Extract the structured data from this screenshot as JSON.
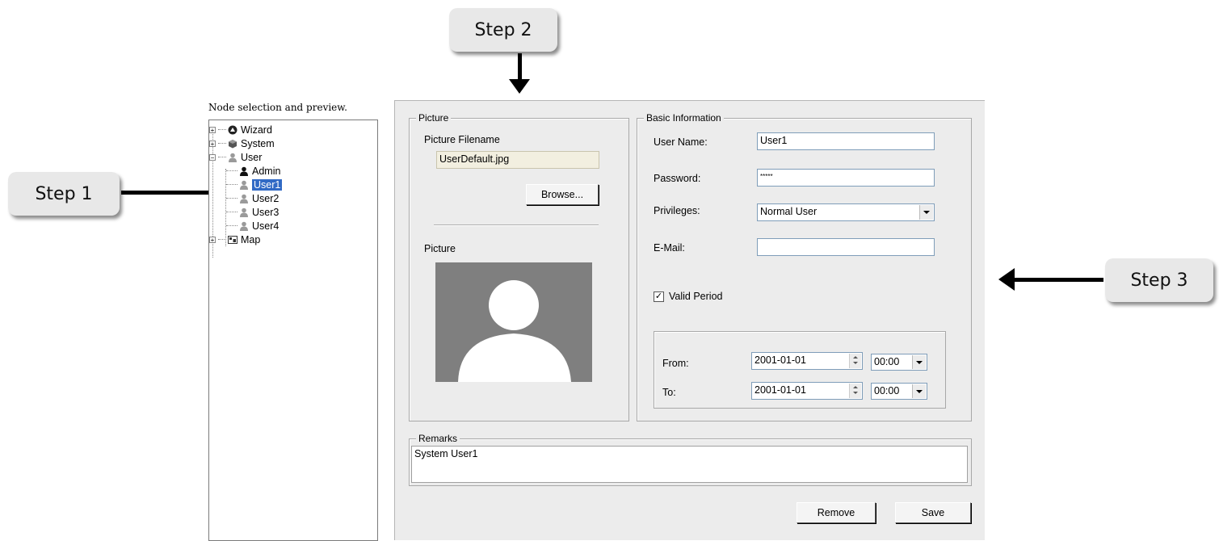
{
  "steps": {
    "step1": "Step 1",
    "step2": "Step 2",
    "step3": "Step 3"
  },
  "tree": {
    "title": "Node selection and preview.",
    "items": [
      {
        "label": "Wizard",
        "icon": "wizard-icon"
      },
      {
        "label": "System",
        "icon": "system-icon"
      },
      {
        "label": "User",
        "icon": "user-icon"
      },
      {
        "label": "Admin",
        "icon": "admin-user-icon"
      },
      {
        "label": "User1",
        "icon": "user-icon"
      },
      {
        "label": "User2",
        "icon": "user-icon"
      },
      {
        "label": "User3",
        "icon": "user-icon"
      },
      {
        "label": "User4",
        "icon": "user-icon"
      },
      {
        "label": "Map",
        "icon": "map-icon"
      }
    ]
  },
  "picture_group": {
    "title": "Picture",
    "filename_label": "Picture Filename",
    "filename_value": "UserDefault.jpg",
    "browse_label": "Browse...",
    "picture_label": "Picture"
  },
  "basic_info": {
    "title": "Basic Information",
    "username_label": "User Name:",
    "username_value": "User1",
    "password_label": "Password:",
    "password_value": "*****",
    "privileges_label": "Privileges:",
    "privileges_value": "Normal User",
    "email_label": "E-Mail:",
    "email_value": "",
    "valid_period_label": "Valid Period",
    "valid_period_checked": true,
    "from_label": "From:",
    "from_date": "2001-01-01",
    "from_time": "00:00",
    "to_label": "To:",
    "to_date": "2001-01-01",
    "to_time": "00:00"
  },
  "remarks": {
    "title": "Remarks",
    "value": "System User1"
  },
  "buttons": {
    "remove": "Remove",
    "save": "Save"
  },
  "colors": {
    "selection": "#316ac5",
    "panel": "#ececec",
    "avatar_bg": "#7f7f7f"
  }
}
